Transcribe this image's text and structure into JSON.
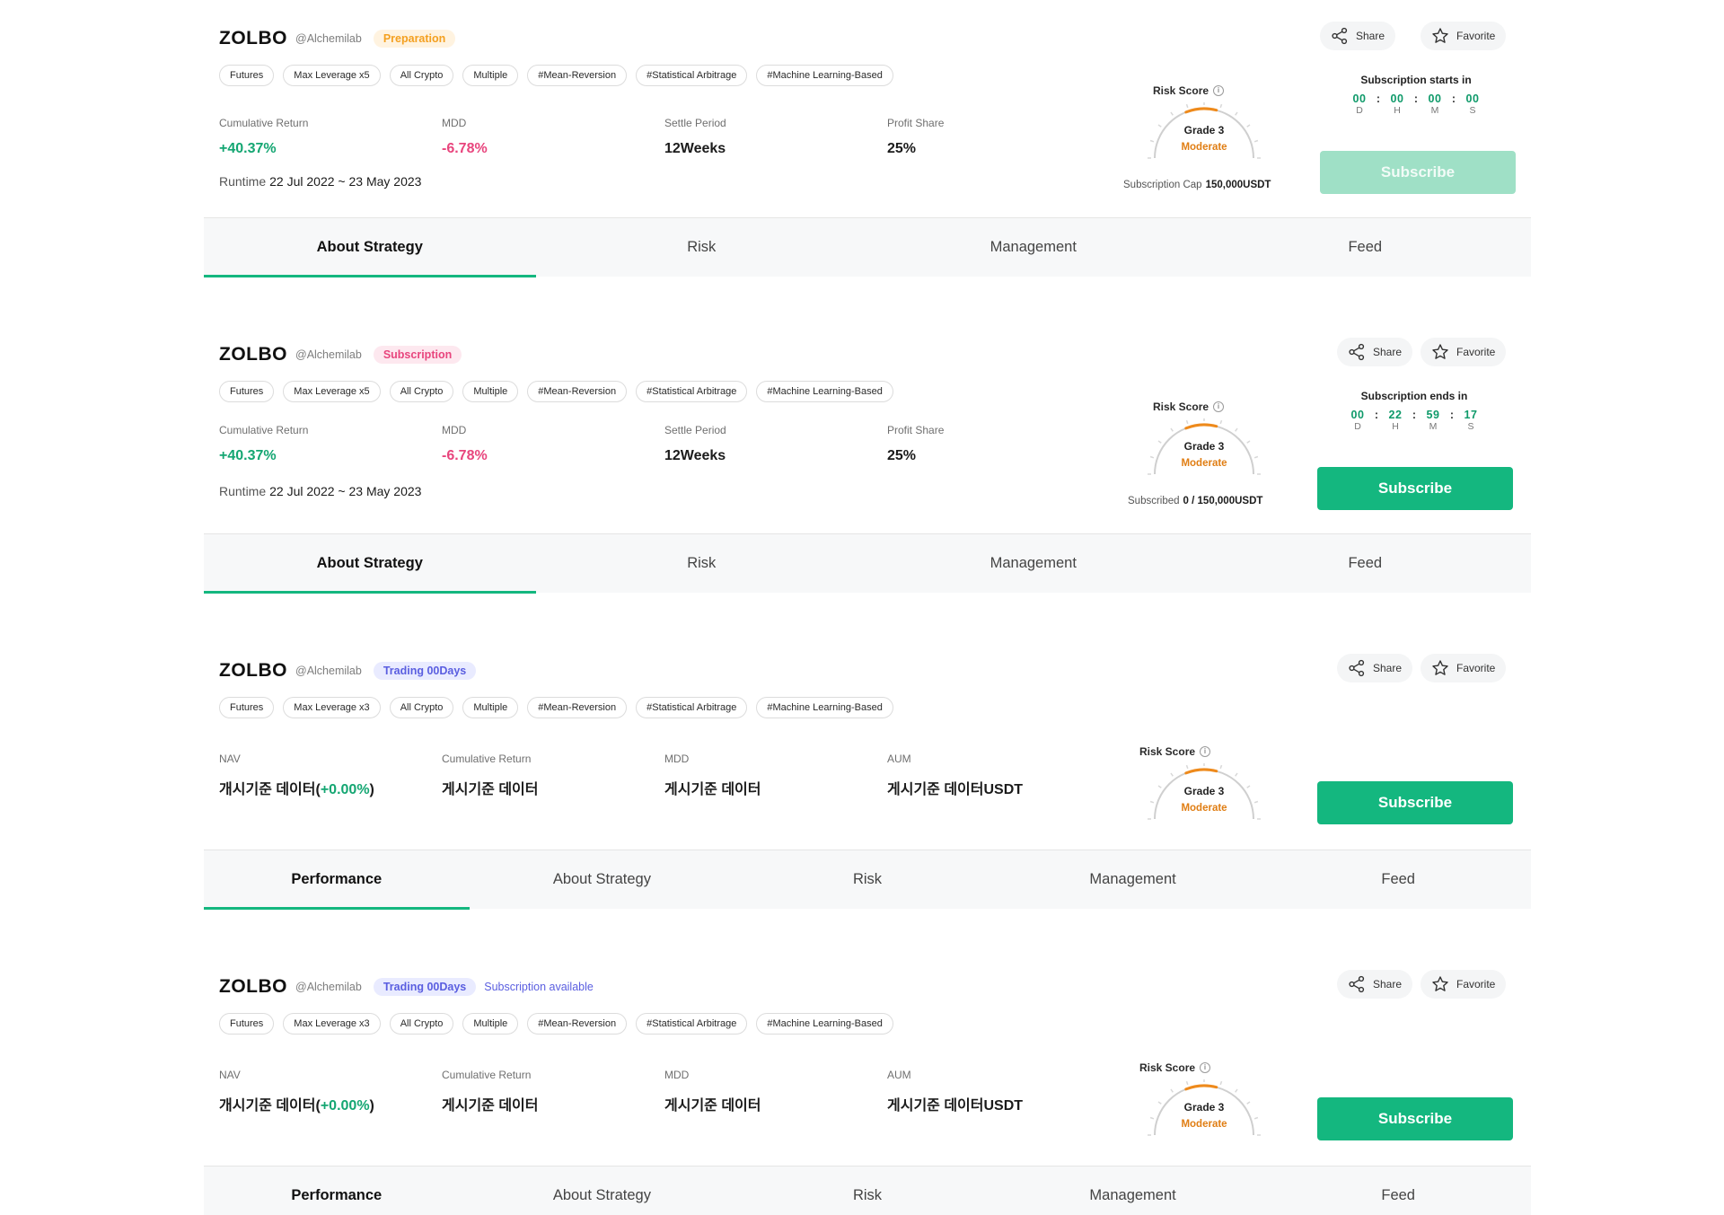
{
  "cards": [
    {
      "name": "ZOLBO",
      "handle": "@Alchemilab",
      "status": {
        "label": "Preparation",
        "kind": "preparation"
      },
      "available": "",
      "tags": [
        "Futures",
        "Max Leverage x5",
        "All Crypto",
        "Multiple",
        "#Mean-Reversion",
        "#Statistical Arbitrage",
        "#Machine Learning-Based"
      ],
      "metrics": [
        {
          "label": "Cumulative Return",
          "value": "+40.37%",
          "tone": "pos"
        },
        {
          "label": "MDD",
          "value": "-6.78%",
          "tone": "neg"
        },
        {
          "label": "Settle Period",
          "value": "12Weeks",
          "tone": ""
        },
        {
          "label": "Profit Share",
          "value": "25%",
          "tone": ""
        }
      ],
      "runtime": {
        "label": "Runtime",
        "value": "22 Jul 2022 ~ 23 May 2023"
      },
      "risk": {
        "title": "Risk Score",
        "grade": "Grade 3",
        "level": "Moderate"
      },
      "cap": {
        "label": "Subscription Cap",
        "value": "150,000USDT"
      },
      "share_label": "Share",
      "favorite_label": "Favorite",
      "countdown": {
        "title": "Subscription starts in",
        "values": [
          "00",
          "00",
          "00",
          "00"
        ],
        "units": [
          "D",
          "H",
          "M",
          "S"
        ]
      },
      "subscribe": {
        "label": "Subscribe",
        "enabled": false
      },
      "tabs": [
        "About Strategy",
        "Risk",
        "Management",
        "Feed"
      ],
      "active_tab": 0
    },
    {
      "name": "ZOLBO",
      "handle": "@Alchemilab",
      "status": {
        "label": "Subscription",
        "kind": "subscription"
      },
      "available": "",
      "tags": [
        "Futures",
        "Max Leverage x5",
        "All Crypto",
        "Multiple",
        "#Mean-Reversion",
        "#Statistical Arbitrage",
        "#Machine Learning-Based"
      ],
      "metrics": [
        {
          "label": "Cumulative Return",
          "value": "+40.37%",
          "tone": "pos"
        },
        {
          "label": "MDD",
          "value": "-6.78%",
          "tone": "neg"
        },
        {
          "label": "Settle Period",
          "value": "12Weeks",
          "tone": ""
        },
        {
          "label": "Profit Share",
          "value": "25%",
          "tone": ""
        }
      ],
      "runtime": {
        "label": "Runtime",
        "value": "22 Jul 2022 ~ 23 May 2023"
      },
      "risk": {
        "title": "Risk Score",
        "grade": "Grade 3",
        "level": "Moderate"
      },
      "cap": {
        "label": "Subscribed",
        "value": "0 / 150,000USDT"
      },
      "share_label": "Share",
      "favorite_label": "Favorite",
      "countdown": {
        "title": "Subscription ends in",
        "values": [
          "00",
          "22",
          "59",
          "17"
        ],
        "units": [
          "D",
          "H",
          "M",
          "S"
        ]
      },
      "subscribe": {
        "label": "Subscribe",
        "enabled": true
      },
      "tabs": [
        "About Strategy",
        "Risk",
        "Management",
        "Feed"
      ],
      "active_tab": 0
    },
    {
      "name": "ZOLBO",
      "handle": "@Alchemilab",
      "status": {
        "label": "Trading 00Days",
        "kind": "trading"
      },
      "available": "",
      "tags": [
        "Futures",
        "Max Leverage x3",
        "All Crypto",
        "Multiple",
        "#Mean-Reversion",
        "#Statistical Arbitrage",
        "#Machine Learning-Based"
      ],
      "metrics": [
        {
          "label": "NAV",
          "value": "개시기준 데이터(",
          "value_green": "+0.00%",
          "value_tail": ")",
          "tone": ""
        },
        {
          "label": "Cumulative Return",
          "value": "게시기준 데이터",
          "tone": ""
        },
        {
          "label": "MDD",
          "value": "게시기준 데이터",
          "tone": ""
        },
        {
          "label": "AUM",
          "value": "게시기준 데이터USDT",
          "tone": ""
        }
      ],
      "runtime": null,
      "risk": {
        "title": "Risk Score",
        "grade": "Grade 3",
        "level": "Moderate"
      },
      "cap": null,
      "share_label": "Share",
      "favorite_label": "Favorite",
      "countdown": null,
      "subscribe": {
        "label": "Subscribe",
        "enabled": true
      },
      "tabs": [
        "Performance",
        "About Strategy",
        "Risk",
        "Management",
        "Feed"
      ],
      "active_tab": 0
    },
    {
      "name": "ZOLBO",
      "handle": "@Alchemilab",
      "status": {
        "label": "Trading 00Days",
        "kind": "trading"
      },
      "available": "Subscription available",
      "tags": [
        "Futures",
        "Max Leverage x3",
        "All Crypto",
        "Multiple",
        "#Mean-Reversion",
        "#Statistical Arbitrage",
        "#Machine Learning-Based"
      ],
      "metrics": [
        {
          "label": "NAV",
          "value": "개시기준 데이터(",
          "value_green": "+0.00%",
          "value_tail": ")",
          "tone": ""
        },
        {
          "label": "Cumulative Return",
          "value": "게시기준 데이터",
          "tone": ""
        },
        {
          "label": "MDD",
          "value": "게시기준 데이터",
          "tone": ""
        },
        {
          "label": "AUM",
          "value": "게시기준 데이터USDT",
          "tone": ""
        }
      ],
      "runtime": null,
      "risk": {
        "title": "Risk Score",
        "grade": "Grade 3",
        "level": "Moderate"
      },
      "cap": null,
      "share_label": "Share",
      "favorite_label": "Favorite",
      "countdown": null,
      "subscribe": {
        "label": "Subscribe",
        "enabled": true
      },
      "tabs": [
        "Performance",
        "About Strategy",
        "Risk",
        "Management",
        "Feed"
      ],
      "active_tab": 0
    }
  ],
  "icons": {
    "share": "share-icon",
    "favorite": "star-icon",
    "info": "info-icon"
  },
  "colors": {
    "accent": "#14b77f",
    "positive": "#14a672",
    "negative": "#e8457d",
    "moderate": "#e07e14"
  }
}
